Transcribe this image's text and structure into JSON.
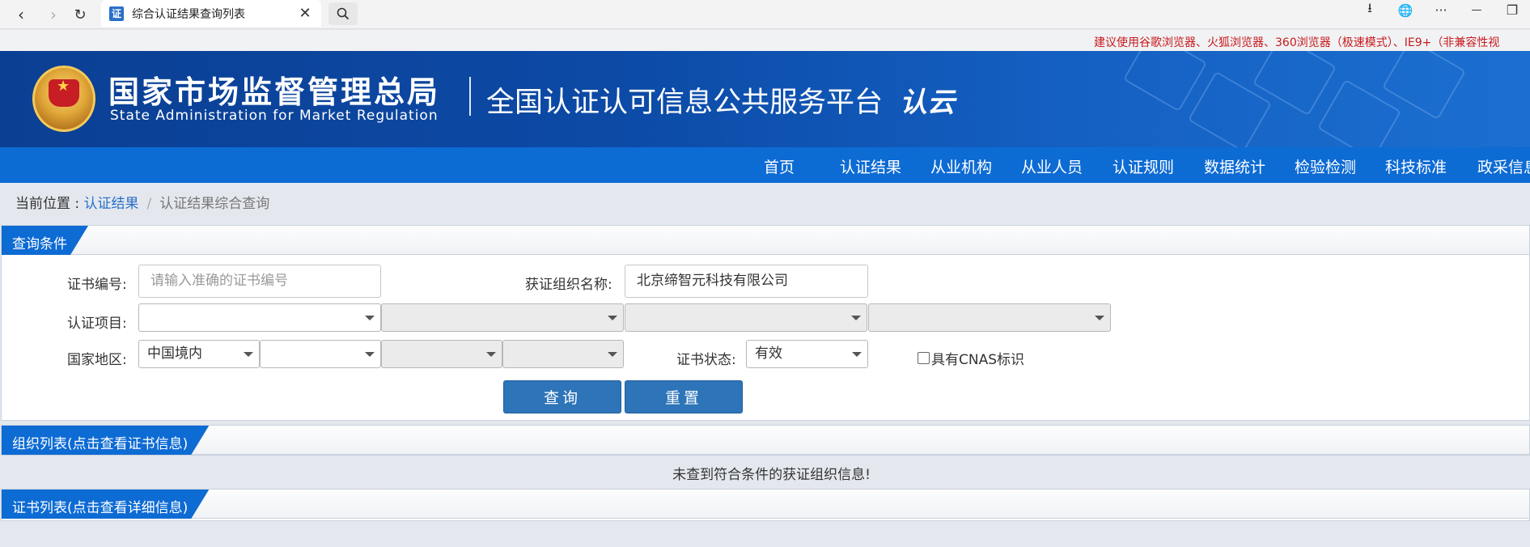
{
  "browser": {
    "tab_title": "综合认证结果查询列表",
    "tab_favicon": "证",
    "back_icon": "‹",
    "forward_icon": "›",
    "reload_icon": "↻",
    "close_icon": "✕",
    "download_icon": "⭳",
    "globe_icon": "🌐",
    "more_icon": "···",
    "minimize_icon": "—",
    "restore_icon": "❐"
  },
  "notice": "建议使用谷歌浏览器、火狐浏览器、360浏览器（极速模式）、IE9+（非兼容性视",
  "banner": {
    "org_cn": "国家市场监督管理总局",
    "org_en": "State Administration  for  Market Regulation",
    "platform": "全国认证认可信息公共服务平台",
    "cloud_logo": "认云"
  },
  "nav": [
    "首页",
    "认证结果",
    "从业机构",
    "从业人员",
    "认证规则",
    "数据统计",
    "检验检测",
    "科技标准",
    "政采信息"
  ],
  "breadcrumb": {
    "label": "当前位置 : ",
    "link": "认证结果",
    "sep": "/",
    "current": "认证结果综合查询"
  },
  "query": {
    "title": "查询条件",
    "cert_no_label": "证书编号:",
    "cert_no_placeholder": "请输入准确的证书编号",
    "org_name_label": "获证组织名称:",
    "org_name_value": "北京缔智元科技有限公司",
    "project_label": "认证项目:",
    "region_label": "国家地区:",
    "region_value": "中国境内",
    "status_label": "证书状态:",
    "status_value": "有效",
    "cnas_label": "具有CNAS标识",
    "search_btn": "查询",
    "reset_btn": "重置"
  },
  "org_list": {
    "title": "组织列表(点击查看证书信息)",
    "empty": "未查到符合条件的获证组织信息!"
  },
  "cert_list": {
    "title": "证书列表(点击查看详细信息)"
  },
  "colors": {
    "nav_blue": "#0d6bd4",
    "button_blue": "#2e74b8",
    "notice_red": "#c8191c",
    "link_blue": "#2a6fc9"
  }
}
